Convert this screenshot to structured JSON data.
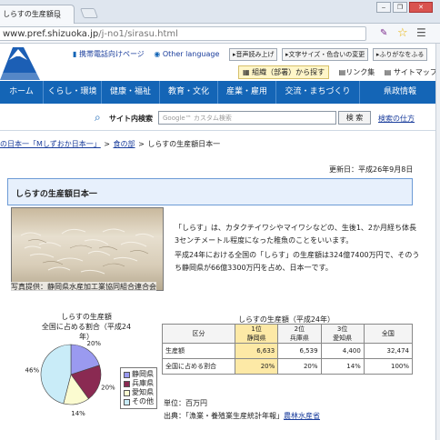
{
  "browser": {
    "tab_title": "しらすの生産額日",
    "url_host": "www.pref.shizuoka.jp",
    "url_path": "/j-no1/sirasu.html",
    "window_buttons": [
      "‒",
      "❐",
      "✕"
    ]
  },
  "header": {
    "mobile_link": "携帯電話向けページ",
    "language_link": "Other language",
    "utility_buttons": [
      "音声読み上げ",
      "文字サイズ・色合いの変更",
      "ふりがなをふる"
    ],
    "find_button": "組織（部署）から探す",
    "links_label": "リンク集",
    "sitemap_label": "サイトマップ"
  },
  "nav": {
    "items": [
      "ホーム",
      "くらし・環境",
      "健康・福祉",
      "教育・文化",
      "産業・雇用",
      "交流・まちづくり",
      "県政情報"
    ]
  },
  "search": {
    "label": "サイト内検索",
    "placeholder": "Google™ カスタム検索",
    "button": "検 索",
    "help": "検索の仕方"
  },
  "breadcrumb": {
    "items": [
      "の日本一「Mしずおか日本一」",
      "食の部"
    ],
    "current": "しらすの生産額日本一"
  },
  "page": {
    "updated": "更新日：平成26年9月8日",
    "title": "しらすの生産額日本一",
    "photo_caption": "写真提供：静岡県水産加工業協同組合連合会",
    "intro_p1": "「しらす」は、カタクチイワシやマイワシなどの、生後1、2か月経ち体長3センチメートル程度になった稚魚のことをいいます。",
    "intro_p2": "平成24年における全国の「しらす」の生産額は324億7400万円で、そのうち静岡県が66億3300万円を占め、日本一です。"
  },
  "chart_data": {
    "type": "pie",
    "title_line1": "しらすの生産額",
    "title_line2": "全国に占める割合（平成24年）",
    "slices": [
      {
        "name": "静岡県",
        "value": 20,
        "label": "20%",
        "color": "#9a9af0"
      },
      {
        "name": "兵庫県",
        "value": 20,
        "label": "20%",
        "color": "#8a2a52"
      },
      {
        "name": "愛知県",
        "value": 14,
        "label": "14%",
        "color": "#fbfbd0"
      },
      {
        "name": "その他",
        "value": 46,
        "label": "46%",
        "color": "#c9ecf8"
      }
    ]
  },
  "table": {
    "caption": "しらすの生産額（平成24年）",
    "corner": "区分",
    "columns": [
      {
        "rank": "1位",
        "name": "静岡県",
        "highlight": true
      },
      {
        "rank": "2位",
        "name": "兵庫県",
        "highlight": false
      },
      {
        "rank": "3位",
        "name": "愛知県",
        "highlight": false
      },
      {
        "rank": "全国",
        "name": "",
        "highlight": false
      }
    ],
    "rows": [
      {
        "label": "生産額",
        "values": [
          "6,633",
          "6,539",
          "4,400",
          "32,474"
        ]
      },
      {
        "label": "全国に占める割合",
        "values": [
          "20%",
          "20%",
          "14%",
          "100%"
        ]
      }
    ],
    "unit": "単位：百万円",
    "source_prefix": "出典：「漁業・養殖業生産統計年報」",
    "source_link": "農林水産省"
  }
}
